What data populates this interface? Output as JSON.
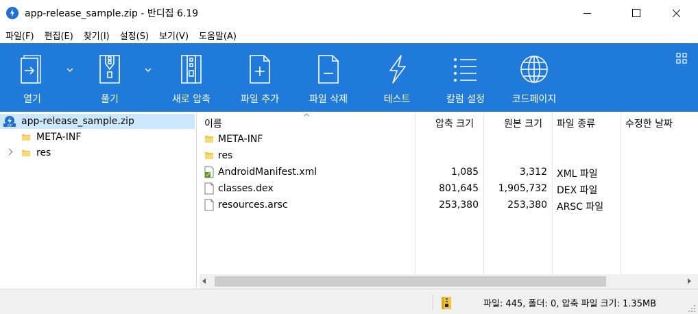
{
  "window": {
    "title": "app-release_sample.zip - 반디집 6.19"
  },
  "menu": [
    {
      "label": "파일(F)"
    },
    {
      "label": "편집(E)"
    },
    {
      "label": "찾기(I)"
    },
    {
      "label": "설정(S)"
    },
    {
      "label": "보기(V)"
    },
    {
      "label": "도움말(A)"
    }
  ],
  "toolbar": {
    "open_label": "열기",
    "extract_label": "풀기",
    "new_archive_label": "새로 압축",
    "add_files_label": "파일 추가",
    "delete_files_label": "파일 삭제",
    "test_label": "테스트",
    "columns_label": "칼럼 설정",
    "codepage_label": "코드페이지"
  },
  "tree": {
    "root": "app-release_sample.zip",
    "children": [
      "META-INF",
      "res"
    ]
  },
  "list": {
    "columns": {
      "name": "이름",
      "packed": "압축 크기",
      "original": "원본 크기",
      "type": "파일 종류",
      "modified": "수정한 날짜"
    },
    "rows": [
      {
        "name": "META-INF",
        "packed": "",
        "original": "",
        "type": "",
        "icon": "folder-icon"
      },
      {
        "name": "res",
        "packed": "",
        "original": "",
        "type": "",
        "icon": "folder-icon"
      },
      {
        "name": "AndroidManifest.xml",
        "packed": "1,085",
        "original": "3,312",
        "type": "XML 파일",
        "icon": "xml-file-icon"
      },
      {
        "name": "classes.dex",
        "packed": "801,645",
        "original": "1,905,732",
        "type": "DEX 파일",
        "icon": "file-icon"
      },
      {
        "name": "resources.arsc",
        "packed": "253,380",
        "original": "253,380",
        "type": "ARSC 파일",
        "icon": "file-icon"
      }
    ]
  },
  "status": {
    "text": "파일: 445, 폴더: 0, 압축 파일 크기: 1.35MB"
  },
  "colors": {
    "toolbar_bg": "#1f7ad9",
    "selection_bg": "#cce8ff",
    "folder": "#f5c342"
  }
}
